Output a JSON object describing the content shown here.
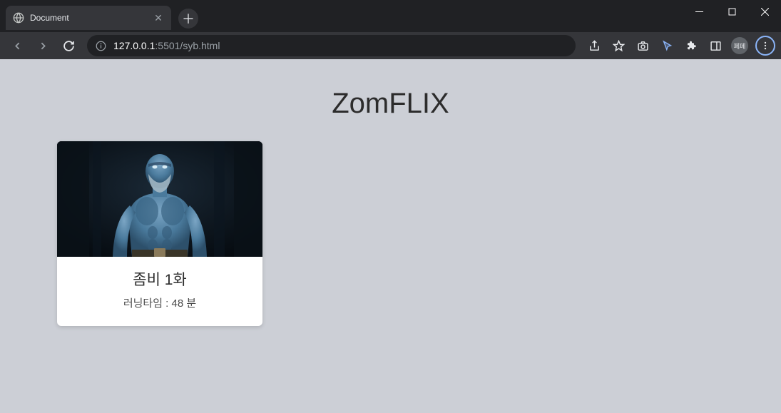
{
  "browser": {
    "tab_title": "Document",
    "url_host": "127.0.0.1",
    "url_port_path": ":5501/syb.html",
    "avatar_label": "페페"
  },
  "page": {
    "title": "ZomFLIX",
    "cards": [
      {
        "title": "좀비 1화",
        "runtime_label": "러닝타임 : 48 분"
      }
    ]
  }
}
